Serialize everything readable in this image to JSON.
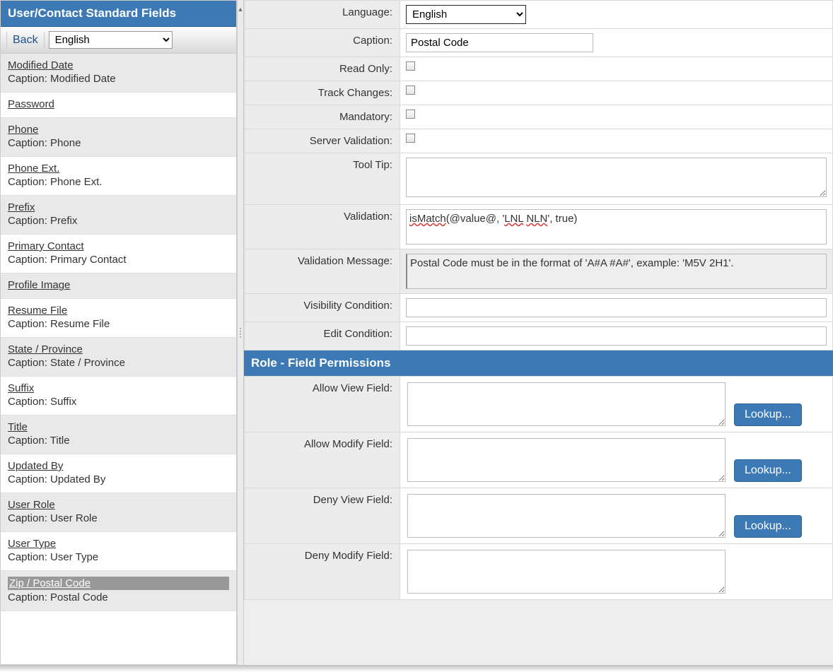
{
  "sidebar": {
    "title": "User/Contact Standard Fields",
    "back_label": "Back",
    "language_options": [
      "English"
    ],
    "language_selected": "English",
    "items": [
      {
        "name": "Modified Date",
        "caption": "Caption: Modified Date"
      },
      {
        "name": "Password",
        "caption": ""
      },
      {
        "name": "Phone",
        "caption": "Caption: Phone"
      },
      {
        "name": "Phone Ext.",
        "caption": "Caption: Phone Ext."
      },
      {
        "name": "Prefix",
        "caption": "Caption: Prefix"
      },
      {
        "name": "Primary Contact",
        "caption": "Caption: Primary Contact"
      },
      {
        "name": "Profile Image",
        "caption": ""
      },
      {
        "name": "Resume File",
        "caption": "Caption: Resume File"
      },
      {
        "name": "State / Province",
        "caption": "Caption: State / Province"
      },
      {
        "name": "Suffix",
        "caption": "Caption: Suffix"
      },
      {
        "name": "Title",
        "caption": "Caption: Title"
      },
      {
        "name": "Updated By",
        "caption": "Caption: Updated By"
      },
      {
        "name": "User Role",
        "caption": "Caption: User Role"
      },
      {
        "name": "User Type",
        "caption": "Caption: User Type"
      },
      {
        "name": "Zip / Postal Code",
        "caption": "Caption: Postal Code"
      }
    ],
    "selected_index": 14
  },
  "form": {
    "labels": {
      "language": "Language:",
      "caption": "Caption:",
      "read_only": "Read Only:",
      "track_changes": "Track Changes:",
      "mandatory": "Mandatory:",
      "server_validation": "Server Validation:",
      "tool_tip": "Tool Tip:",
      "validation": "Validation:",
      "validation_message": "Validation Message:",
      "visibility_condition": "Visibility Condition:",
      "edit_condition": "Edit Condition:"
    },
    "values": {
      "language": "English",
      "caption": "Postal Code",
      "read_only": false,
      "track_changes": false,
      "mandatory": false,
      "server_validation": false,
      "tool_tip": "",
      "validation": "isMatch(@value@, 'LNL NLN', true)",
      "validation_message": "Postal Code must be in the format of 'A#A #A#', example: 'M5V 2H1'.",
      "visibility_condition": "",
      "edit_condition": ""
    }
  },
  "permissions": {
    "section_title": "Role - Field Permissions",
    "lookup_label": "Lookup...",
    "rows": [
      {
        "label": "Allow View Field:",
        "value": ""
      },
      {
        "label": "Allow Modify Field:",
        "value": ""
      },
      {
        "label": "Deny View Field:",
        "value": ""
      },
      {
        "label": "Deny Modify Field:",
        "value": ""
      }
    ]
  }
}
